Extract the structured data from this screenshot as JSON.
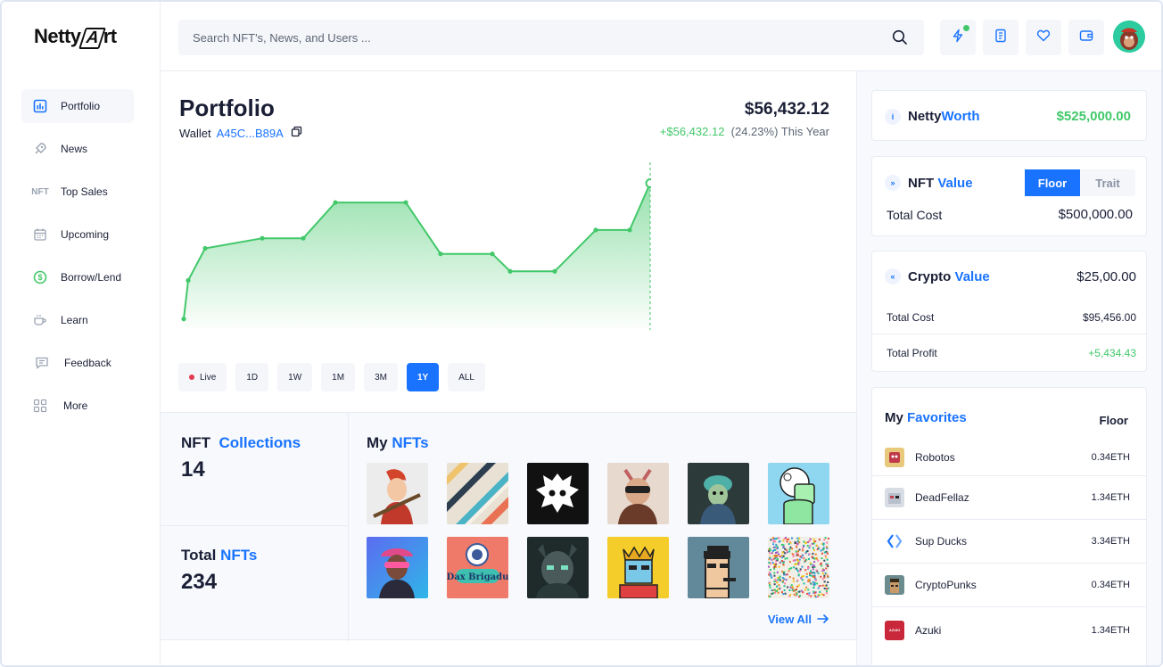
{
  "app": {
    "logo_text_1": "Netty",
    "logo_text_2": "rt",
    "logo_mark": "A"
  },
  "sidebar": {
    "items": [
      {
        "label": "Portfolio",
        "icon": "bar-chart-icon"
      },
      {
        "label": "News",
        "icon": "rocket-icon"
      },
      {
        "label": "Top Sales",
        "icon": "nft-icon",
        "prefix": "NFT"
      },
      {
        "label": "Upcoming",
        "icon": "calendar-icon"
      },
      {
        "label": "Borrow/Lend",
        "icon": "dollar-icon"
      },
      {
        "label": "Learn",
        "icon": "cup-icon"
      },
      {
        "label": "Feedback",
        "icon": "message-icon"
      },
      {
        "label": "More",
        "icon": "grid-icon"
      }
    ]
  },
  "header": {
    "search_placeholder": "Search NFT's, News, and Users ...",
    "search_value": ""
  },
  "portfolio": {
    "title": "Portfolio",
    "wallet_label": "Wallet",
    "wallet_address": "A45C...B89A",
    "value": "$56,432.12",
    "change_amount": "+$56,432.12",
    "change_pct": "(24.23%) This Year",
    "ranges": [
      {
        "label": "Live"
      },
      {
        "label": "1D"
      },
      {
        "label": "1W"
      },
      {
        "label": "1M"
      },
      {
        "label": "3M"
      },
      {
        "label": "1Y"
      },
      {
        "label": "ALL"
      }
    ],
    "active_range": "1Y"
  },
  "chart_data": {
    "type": "area",
    "title": "",
    "xlabel": "",
    "ylabel": "",
    "series": [
      {
        "values": [
          10,
          52,
          87,
          98,
          98,
          137,
          137,
          81,
          81,
          62,
          62,
          107,
          107,
          158
        ]
      }
    ],
    "ylim": [
      0,
      175
    ],
    "grid": false,
    "color": "#42c86a"
  },
  "stats": {
    "collections_label_1": "NFT",
    "collections_label_2": "Collections",
    "collections_value": "14",
    "total_label_1": "Total",
    "total_label_2": "NFTs",
    "total_value": "234"
  },
  "my_nfts": {
    "title_1": "My",
    "title_2": "NFTs",
    "view_all": "View All",
    "badge_text": "Dax Brigadu"
  },
  "right": {
    "worth_title_1": "Netty",
    "worth_title_2": "Worth",
    "worth_value": "$525,000.00",
    "nft_value_title_1": "NFT",
    "nft_value_title_2": "Value",
    "floor_label": "Floor",
    "trait_label": "Trait",
    "nft_total_cost_label": "Total Cost",
    "nft_total_cost_value": "$500,000.00",
    "crypto_title_1": "Crypto",
    "crypto_title_2": "Value",
    "crypto_value": "$25,00.00",
    "crypto_total_cost_label": "Total Cost",
    "crypto_total_cost_value": "$95,456.00",
    "crypto_profit_label": "Total Profit",
    "crypto_profit_value": "+5,434.43",
    "fav_title_1": "My",
    "fav_title_2": "Favorites",
    "fav_col": "Floor",
    "favorites": [
      {
        "name": "Robotos",
        "price": "0.34ETH",
        "color": "#e8c87a"
      },
      {
        "name": "DeadFellaz",
        "price": "1.34ETH",
        "color": "#d8dce4"
      },
      {
        "name": "Sup Ducks",
        "price": "3.34ETH",
        "color": "#ffffff"
      },
      {
        "name": "CryptoPunks",
        "price": "0.34ETH",
        "color": "#6b8b8f"
      },
      {
        "name": "Azuki",
        "price": "1.34ETH",
        "color": "#c8283a",
        "badge": "AZUKI"
      }
    ]
  },
  "colors": {
    "accent": "#1973ff",
    "positive": "#42c86a",
    "live": "#e53950"
  }
}
